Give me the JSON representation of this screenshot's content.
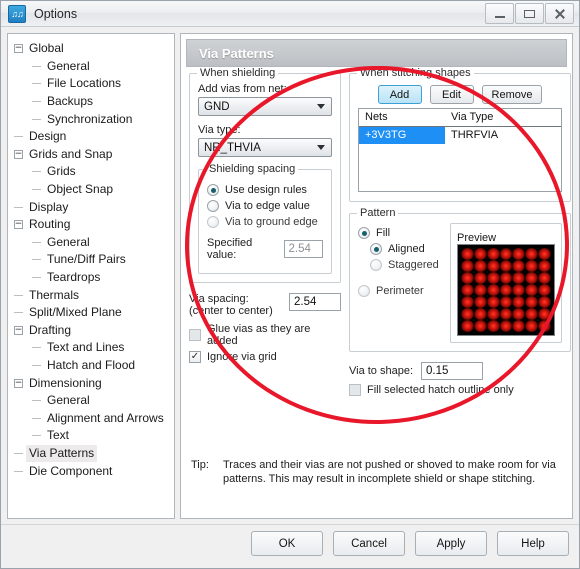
{
  "window": {
    "title": "Options",
    "app_icon": "music-note-icon",
    "controls": {
      "minimize": "minimize-icon",
      "maximize": "maximize-icon",
      "close": "close-icon"
    }
  },
  "tree": {
    "items": [
      {
        "label": "Global",
        "level": 0,
        "expander": "minus",
        "selected": false
      },
      {
        "label": "General",
        "level": 1,
        "expander": "none",
        "selected": false
      },
      {
        "label": "File Locations",
        "level": 1,
        "expander": "none",
        "selected": false
      },
      {
        "label": "Backups",
        "level": 1,
        "expander": "none",
        "selected": false
      },
      {
        "label": "Synchronization",
        "level": 1,
        "expander": "none",
        "selected": false
      },
      {
        "label": "Design",
        "level": 0,
        "expander": "none",
        "selected": false
      },
      {
        "label": "Grids and Snap",
        "level": 0,
        "expander": "minus",
        "selected": false
      },
      {
        "label": "Grids",
        "level": 1,
        "expander": "none",
        "selected": false
      },
      {
        "label": "Object Snap",
        "level": 1,
        "expander": "none",
        "selected": false
      },
      {
        "label": "Display",
        "level": 0,
        "expander": "none",
        "selected": false
      },
      {
        "label": "Routing",
        "level": 0,
        "expander": "minus",
        "selected": false
      },
      {
        "label": "General",
        "level": 1,
        "expander": "none",
        "selected": false
      },
      {
        "label": "Tune/Diff Pairs",
        "level": 1,
        "expander": "none",
        "selected": false
      },
      {
        "label": "Teardrops",
        "level": 1,
        "expander": "none",
        "selected": false
      },
      {
        "label": "Thermals",
        "level": 0,
        "expander": "none",
        "selected": false
      },
      {
        "label": "Split/Mixed Plane",
        "level": 0,
        "expander": "none",
        "selected": false
      },
      {
        "label": "Drafting",
        "level": 0,
        "expander": "minus",
        "selected": false
      },
      {
        "label": "Text and Lines",
        "level": 1,
        "expander": "none",
        "selected": false
      },
      {
        "label": "Hatch and Flood",
        "level": 1,
        "expander": "none",
        "selected": false
      },
      {
        "label": "Dimensioning",
        "level": 0,
        "expander": "minus",
        "selected": false
      },
      {
        "label": "General",
        "level": 1,
        "expander": "none",
        "selected": false
      },
      {
        "label": "Alignment and Arrows",
        "level": 1,
        "expander": "none",
        "selected": false
      },
      {
        "label": "Text",
        "level": 1,
        "expander": "none",
        "selected": false
      },
      {
        "label": "Via Patterns",
        "level": 0,
        "expander": "none",
        "selected": true
      },
      {
        "label": "Die Component",
        "level": 0,
        "expander": "none",
        "selected": false
      }
    ]
  },
  "page": {
    "banner_title": "Via Patterns",
    "shielding": {
      "group_title": "When shielding",
      "net_label": "Add vias from net:",
      "net_value": "GND",
      "via_type_label": "Via type:",
      "via_type_value": "NR_THVIA",
      "spacing_group_title": "Shielding spacing",
      "options": [
        {
          "label": "Use design rules",
          "selected": true,
          "enabled": true
        },
        {
          "label": "Via to edge value",
          "selected": false,
          "enabled": true
        },
        {
          "label": "Via to ground edge",
          "selected": false,
          "enabled": false
        }
      ],
      "specified_label": "Specified value:",
      "specified_value": "2.54",
      "via_spacing_label": "Via spacing:",
      "via_spacing_sublabel": "(center to center)",
      "via_spacing_value": "2.54",
      "glue_label": "Glue vias as they are added",
      "glue_checked": false,
      "ignore_grid_label": "Ignore via grid",
      "ignore_grid_checked": true,
      "check_glyph": "✓"
    },
    "stitching": {
      "group_title": "When stitching shapes",
      "buttons": [
        {
          "label": "Add",
          "highlighted": true
        },
        {
          "label": "Edit",
          "highlighted": false
        },
        {
          "label": "Remove",
          "highlighted": false
        }
      ],
      "columns": [
        "Nets",
        "Via Type"
      ],
      "rows": [
        {
          "net": "+3V3TG",
          "via_type": "THRFVIA",
          "selected": true
        }
      ]
    },
    "pattern": {
      "group_title": "Pattern",
      "options": [
        {
          "label": "Fill",
          "selected": true,
          "enabled": true
        },
        {
          "label": "Aligned",
          "selected": true,
          "enabled": true
        },
        {
          "label": "Staggered",
          "selected": false,
          "enabled": false
        },
        {
          "label": "Perimeter",
          "selected": false,
          "enabled": false
        }
      ],
      "preview_title": "Preview",
      "preview_grid_cols": 7,
      "preview_grid_rows": 7,
      "preview_via_color": "#e01a10",
      "preview_background": "#000000"
    },
    "via_to_shape": {
      "label": "Via to shape:",
      "value": "0.15",
      "fill_outline_label": "Fill selected hatch outline only",
      "fill_outline_checked": false
    },
    "tip": {
      "word": "Tip:",
      "text": "Traces and their vias are not pushed or shoved to make room for via patterns. This may result in incomplete shield or shape stitching."
    },
    "annotation": {
      "shape": "ellipse-highlight",
      "color": "#e8172a"
    }
  },
  "footer": {
    "buttons": [
      "OK",
      "Cancel",
      "Apply",
      "Help"
    ]
  }
}
